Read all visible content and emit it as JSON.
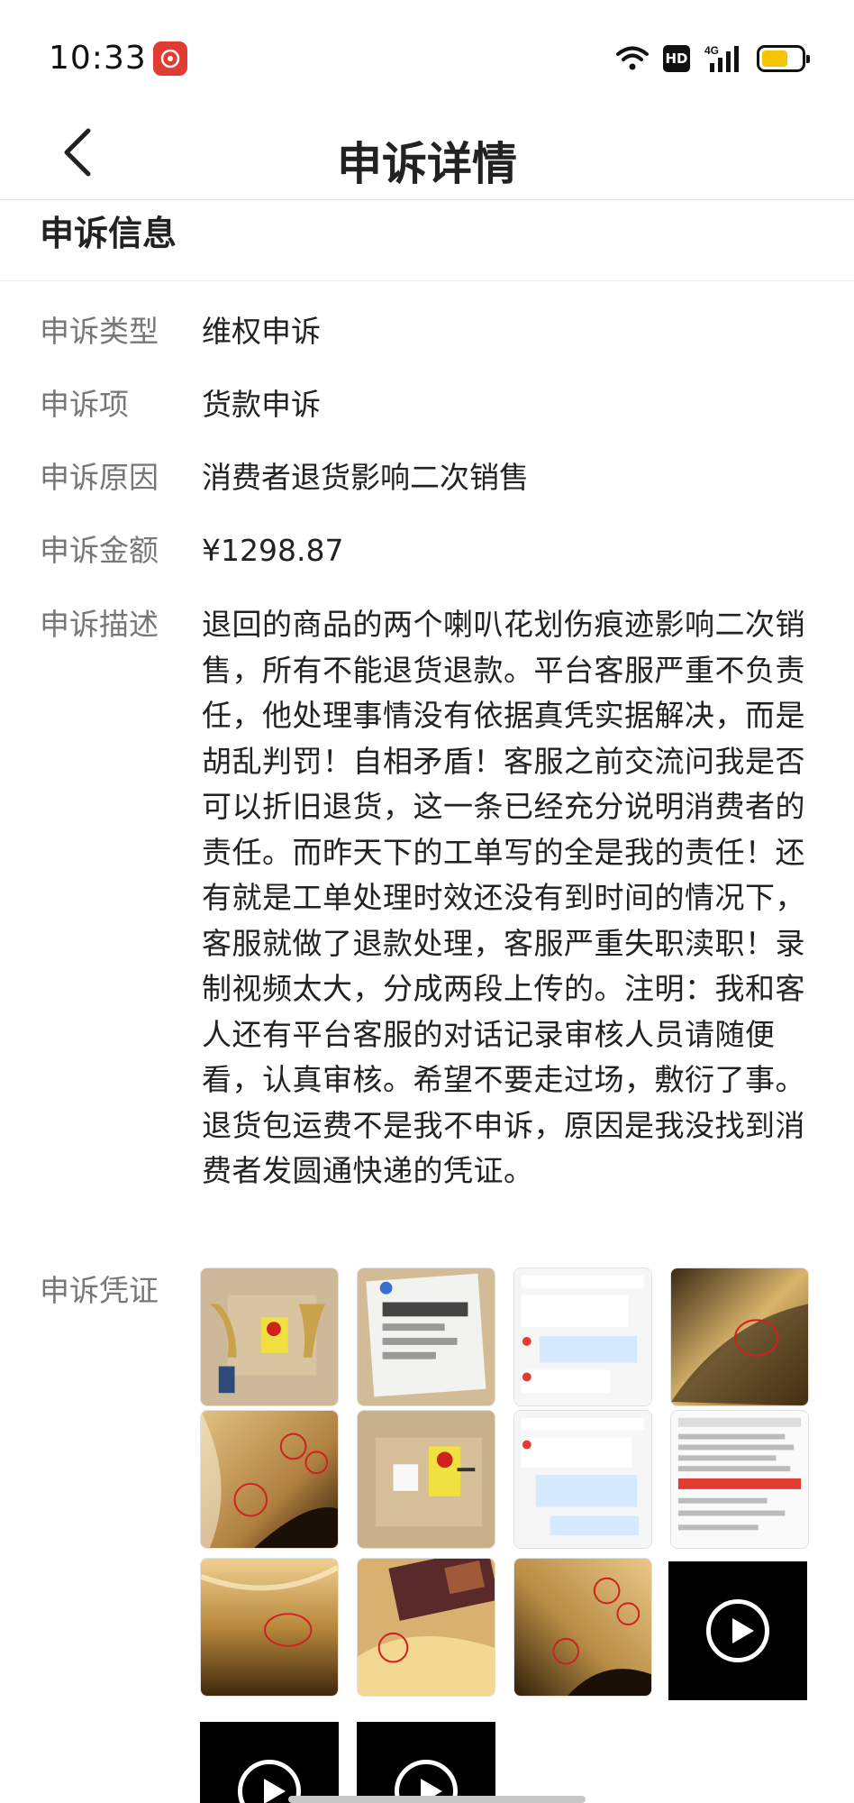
{
  "status_bar": {
    "time": "10:33",
    "app_icon": "pinduoduo-app-icon",
    "icons": [
      "wifi-icon",
      "hd-icon",
      "signal-4g-icon",
      "battery-icon"
    ],
    "hd_label": "HD",
    "network_label": "4G",
    "battery_color": "#f5c400"
  },
  "nav": {
    "back_icon": "chevron-left-icon",
    "title": "申诉详情"
  },
  "section": {
    "title": "申诉信息"
  },
  "fields": [
    {
      "label": "申诉类型",
      "value": "维权申诉"
    },
    {
      "label": "申诉项",
      "value": "货款申诉"
    },
    {
      "label": "申诉原因",
      "value": "消费者退货影响二次销售"
    },
    {
      "label": "申诉金额",
      "value": "¥1298.87"
    },
    {
      "label": "申诉描述",
      "value": "退回的商品的两个喇叭花划伤痕迹影响二次销售，所有不能退货退款。平台客服严重不负责任，他处理事情没有依据真凭实据解决，而是胡乱判罚！自相矛盾！客服之前交流问我是否可以折旧退货，这一条已经充分说明消费者的责任。而昨天下的工单写的全是我的责任！还有就是工单处理时效还没有到时间的情况下，客服就做了退款处理，客服严重失职渎职！录制视频太大，分成两段上传的。注明：我和客人还有平台客服的对话记录审核人员请随便看，认真审核。希望不要走过场，敷衍了事。退货包运费不是我不申诉，原因是我没找到消费者发圆通快递的凭证。"
    }
  ],
  "proof": {
    "label": "申诉凭证",
    "items": [
      {
        "type": "image",
        "name": "photo-package-with-horns"
      },
      {
        "type": "image",
        "name": "photo-shipping-label"
      },
      {
        "type": "image",
        "name": "screenshot-chat-record"
      },
      {
        "type": "image",
        "name": "photo-horn-scratch-closeup"
      },
      {
        "type": "image",
        "name": "photo-horn-scratch-circled"
      },
      {
        "type": "image",
        "name": "photo-package-box"
      },
      {
        "type": "image",
        "name": "screenshot-chat-record-2"
      },
      {
        "type": "image",
        "name": "screenshot-work-order"
      },
      {
        "type": "image",
        "name": "photo-horn-bell-scratch"
      },
      {
        "type": "image",
        "name": "photo-horn-case"
      },
      {
        "type": "image",
        "name": "photo-horn-scratch-marked"
      },
      {
        "type": "video",
        "name": "video-1"
      },
      {
        "type": "video",
        "name": "video-2"
      },
      {
        "type": "video",
        "name": "video-3"
      }
    ]
  }
}
